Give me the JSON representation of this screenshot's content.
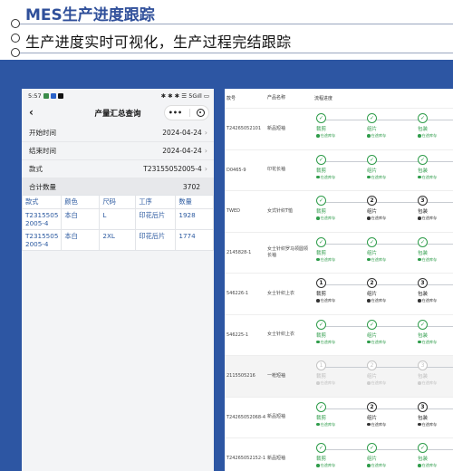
{
  "header": {
    "title": "MES生产进度跟踪",
    "subtitle": "生产进度实时可视化，生产过程完结跟踪"
  },
  "phone": {
    "status_time": "5:57",
    "status_right": "✱ ✱ ✱ ☰ 5Gıll ▭",
    "nav_back": "‹",
    "nav_title": "产量汇总查询",
    "capsule_more": "•••",
    "fields": [
      {
        "label": "开始时间",
        "value": "2024-04-24"
      },
      {
        "label": "结束时间",
        "value": "2024-04-24"
      },
      {
        "label": "款式",
        "value": "T23155052005-4"
      }
    ],
    "total": {
      "label": "合计数量",
      "value": "3702"
    },
    "table": {
      "headers": [
        "款式",
        "颜色",
        "尺码",
        "工序",
        "数量"
      ],
      "rows": [
        [
          "T2315505 2005-4",
          "本白",
          "L",
          "印花后片",
          "1928"
        ],
        [
          "T2315505 2005-4",
          "本白",
          "2XL",
          "印花后片",
          "1774"
        ]
      ]
    }
  },
  "tablet": {
    "headers": [
      "款号",
      "产品名称",
      "流程进度"
    ],
    "rows": [
      {
        "order": "T24265052101",
        "name": "新品短袖",
        "steps": [
          {
            "icon": "✓",
            "label": "裁剪",
            "info": "在途库存",
            "state": "done"
          },
          {
            "icon": "✓",
            "label": "组片",
            "info": "在途库存",
            "state": "done"
          },
          {
            "icon": "✓",
            "label": "包装",
            "info": "在途库存",
            "state": "done"
          }
        ]
      },
      {
        "order": "D0465-9",
        "name": "印花长袖",
        "steps": [
          {
            "icon": "✓",
            "label": "裁剪",
            "info": "在途库存",
            "state": "done"
          },
          {
            "icon": "✓",
            "label": "组片",
            "info": "在途库存",
            "state": "done"
          },
          {
            "icon": "✓",
            "label": "包装",
            "info": "在途库存",
            "state": "done"
          }
        ]
      },
      {
        "order": "TWED",
        "name": "女式针织T恤",
        "steps": [
          {
            "icon": "✓",
            "label": "裁剪",
            "info": "在途库存",
            "state": "done"
          },
          {
            "icon": "2",
            "label": "组片",
            "info": "在途库存",
            "state": "num"
          },
          {
            "icon": "3",
            "label": "包装",
            "info": "在途库存",
            "state": "num"
          }
        ]
      },
      {
        "order": "2145828-1",
        "name": "女士针织罗马领圆领长袖",
        "steps": [
          {
            "icon": "✓",
            "label": "裁剪",
            "info": "在途库存",
            "state": "done"
          },
          {
            "icon": "✓",
            "label": "组片",
            "info": "在途库存",
            "state": "done"
          },
          {
            "icon": "✓",
            "label": "包装",
            "info": "在途库存",
            "state": "done"
          }
        ]
      },
      {
        "order": "546226-1",
        "name": "女士针织上衣",
        "steps": [
          {
            "icon": "1",
            "label": "裁剪",
            "info": "在途库存",
            "state": "num"
          },
          {
            "icon": "2",
            "label": "组片",
            "info": "在途库存",
            "state": "num"
          },
          {
            "icon": "3",
            "label": "包装",
            "info": "在途库存",
            "state": "num"
          }
        ]
      },
      {
        "order": "546225-1",
        "name": "女士针织上衣",
        "steps": [
          {
            "icon": "✓",
            "label": "裁剪",
            "info": "在途库存",
            "state": "done"
          },
          {
            "icon": "✓",
            "label": "组片",
            "info": "在途库存",
            "state": "done"
          },
          {
            "icon": "✓",
            "label": "包装",
            "info": "在途库存",
            "state": "done"
          }
        ]
      },
      {
        "order": "2115505216",
        "name": "一枪短袖",
        "steps": [
          {
            "icon": "1",
            "label": "裁剪",
            "info": "在途库存",
            "state": "faded"
          },
          {
            "icon": "2",
            "label": "组片",
            "info": "在途库存",
            "state": "faded"
          },
          {
            "icon": "3",
            "label": "包装",
            "info": "在途库存",
            "state": "faded"
          }
        ]
      },
      {
        "order": "T24265052068-4",
        "name": "新品短袖",
        "steps": [
          {
            "icon": "✓",
            "label": "裁剪",
            "info": "在途库存",
            "state": "done"
          },
          {
            "icon": "2",
            "label": "组片",
            "info": "在途库存",
            "state": "num"
          },
          {
            "icon": "3",
            "label": "包装",
            "info": "在途库存",
            "state": "num"
          }
        ]
      },
      {
        "order": "T24265052152-1",
        "name": "新品短袖",
        "steps": [
          {
            "icon": "✓",
            "label": "裁剪",
            "info": "在途库存",
            "state": "done"
          },
          {
            "icon": "✓",
            "label": "组片",
            "info": "在途库存",
            "state": "done"
          },
          {
            "icon": "✓",
            "label": "包装",
            "info": "在途库存",
            "state": "done"
          }
        ]
      }
    ]
  }
}
